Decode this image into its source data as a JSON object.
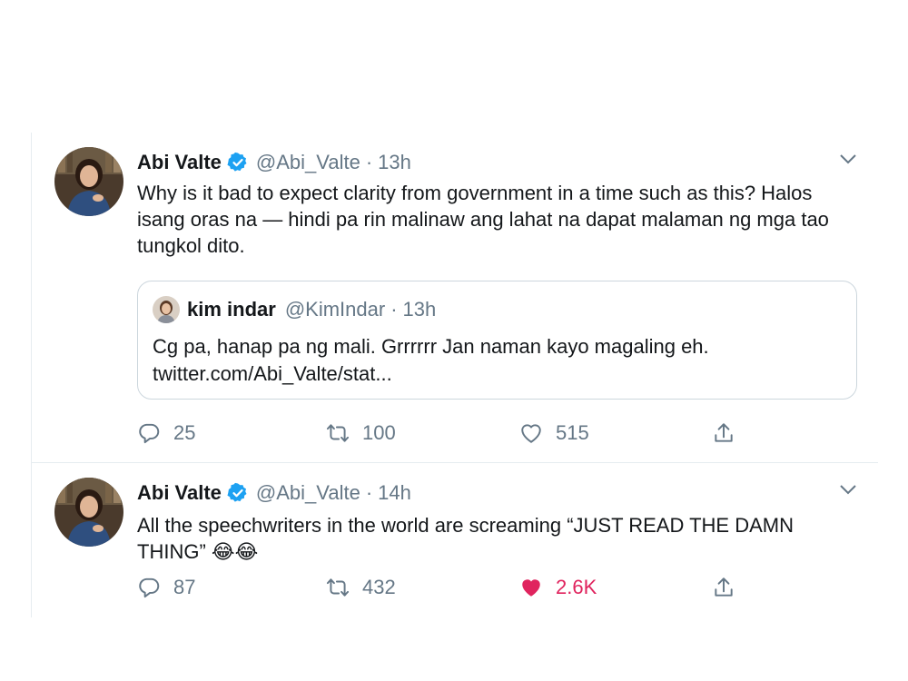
{
  "tweets": [
    {
      "author_name": "Abi Valte",
      "author_handle": "@Abi_Valte",
      "separator": "·",
      "time": "13h",
      "text_lines": [
        "Why is it bad to expect clarity from government in a time such as this? Halos",
        "isang oras na — hindi pa rin malinaw ang lahat na dapat malaman ng mga tao",
        "tungkol dito."
      ],
      "quote": {
        "author_name": "kim indar",
        "author_handle": "@KimIndar",
        "separator": "·",
        "time": "13h",
        "text_lines": [
          "Cg pa, hanap pa ng mali. Grrrrrr Jan naman kayo magaling eh.",
          "twitter.com/Abi_Valte/stat..."
        ]
      },
      "stats": {
        "replies": "25",
        "retweets": "100",
        "likes": "515"
      }
    },
    {
      "author_name": "Abi Valte",
      "author_handle": "@Abi_Valte",
      "separator": "·",
      "time": "14h",
      "text_lines": [
        "All the speechwriters in the world are screaming “JUST READ THE DAMN",
        "THING” 😂😂"
      ],
      "stats": {
        "replies": "87",
        "retweets": "432",
        "likes": "2.6K"
      }
    }
  ],
  "icons": {
    "verified": "verified-badge-icon",
    "caret": "chevron-down-icon",
    "reply": "reply-icon",
    "retweet": "retweet-icon",
    "like": "heart-icon",
    "share": "share-icon"
  },
  "colors": {
    "text": "#14171a",
    "muted": "#657786",
    "verified": "#1da1f2",
    "like_active": "#e0245e",
    "border": "#e6ecf0"
  }
}
